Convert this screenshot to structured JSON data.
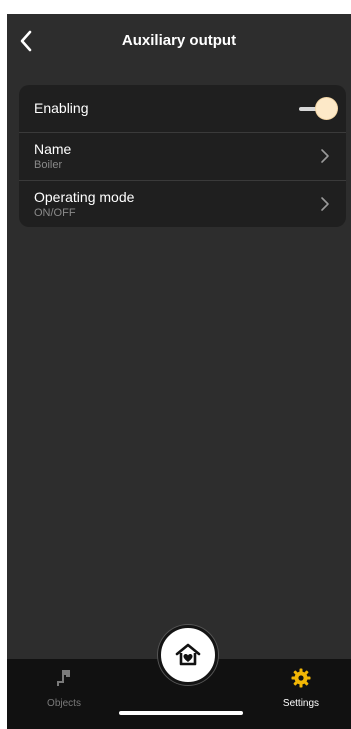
{
  "header": {
    "title": "Auxiliary output"
  },
  "settings": {
    "enabling": {
      "label": "Enabling",
      "enabled": true
    },
    "name": {
      "label": "Name",
      "value": "Boiler"
    },
    "operating_mode": {
      "label": "Operating mode",
      "value": "ON/OFF"
    }
  },
  "tabbar": {
    "objects_label": "Objects",
    "settings_label": "Settings",
    "active_tab": "Settings"
  },
  "colors": {
    "background": "#2d2d2d",
    "card": "#1f1f1f",
    "tabbar": "#111111",
    "accent": "#f2b705",
    "toggle_knob": "#fde9c8"
  },
  "icons": {
    "back": "back-chevron-icon",
    "row_chevron": "chevron-right-icon",
    "objects": "faucet-icon",
    "settings": "gear-icon",
    "home": "home-heart-icon"
  }
}
